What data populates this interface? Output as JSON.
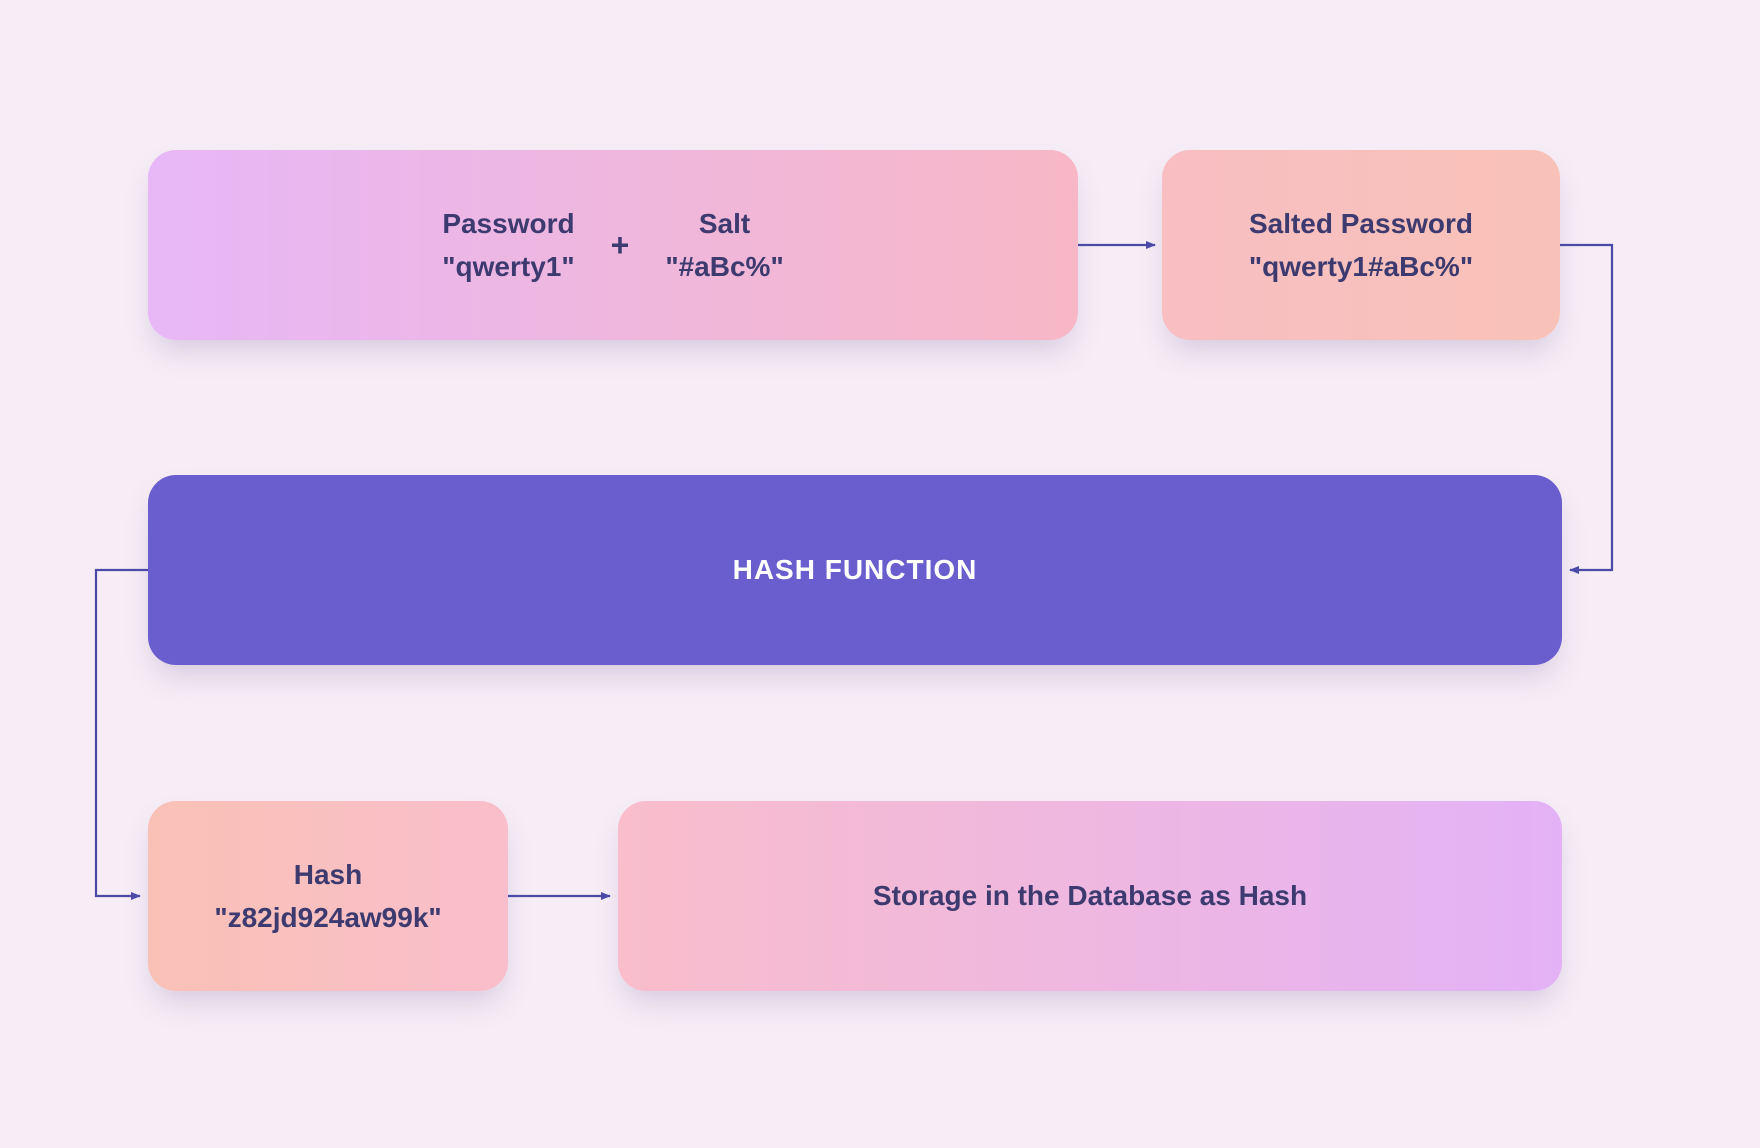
{
  "password_salt": {
    "password_label": "Password",
    "password_value": "\"qwerty1\"",
    "plus": "+",
    "salt_label": "Salt",
    "salt_value": "\"#aBc%\""
  },
  "salted": {
    "label": "Salted Password",
    "value": "\"qwerty1#aBc%\""
  },
  "hash_function": {
    "label": "HASH FUNCTION"
  },
  "hash_output": {
    "label": "Hash",
    "value": "\"z82jd924aw99k\""
  },
  "storage": {
    "label": "Storage in the Database as Hash"
  },
  "colors": {
    "arrow": "#4b4aa7"
  }
}
